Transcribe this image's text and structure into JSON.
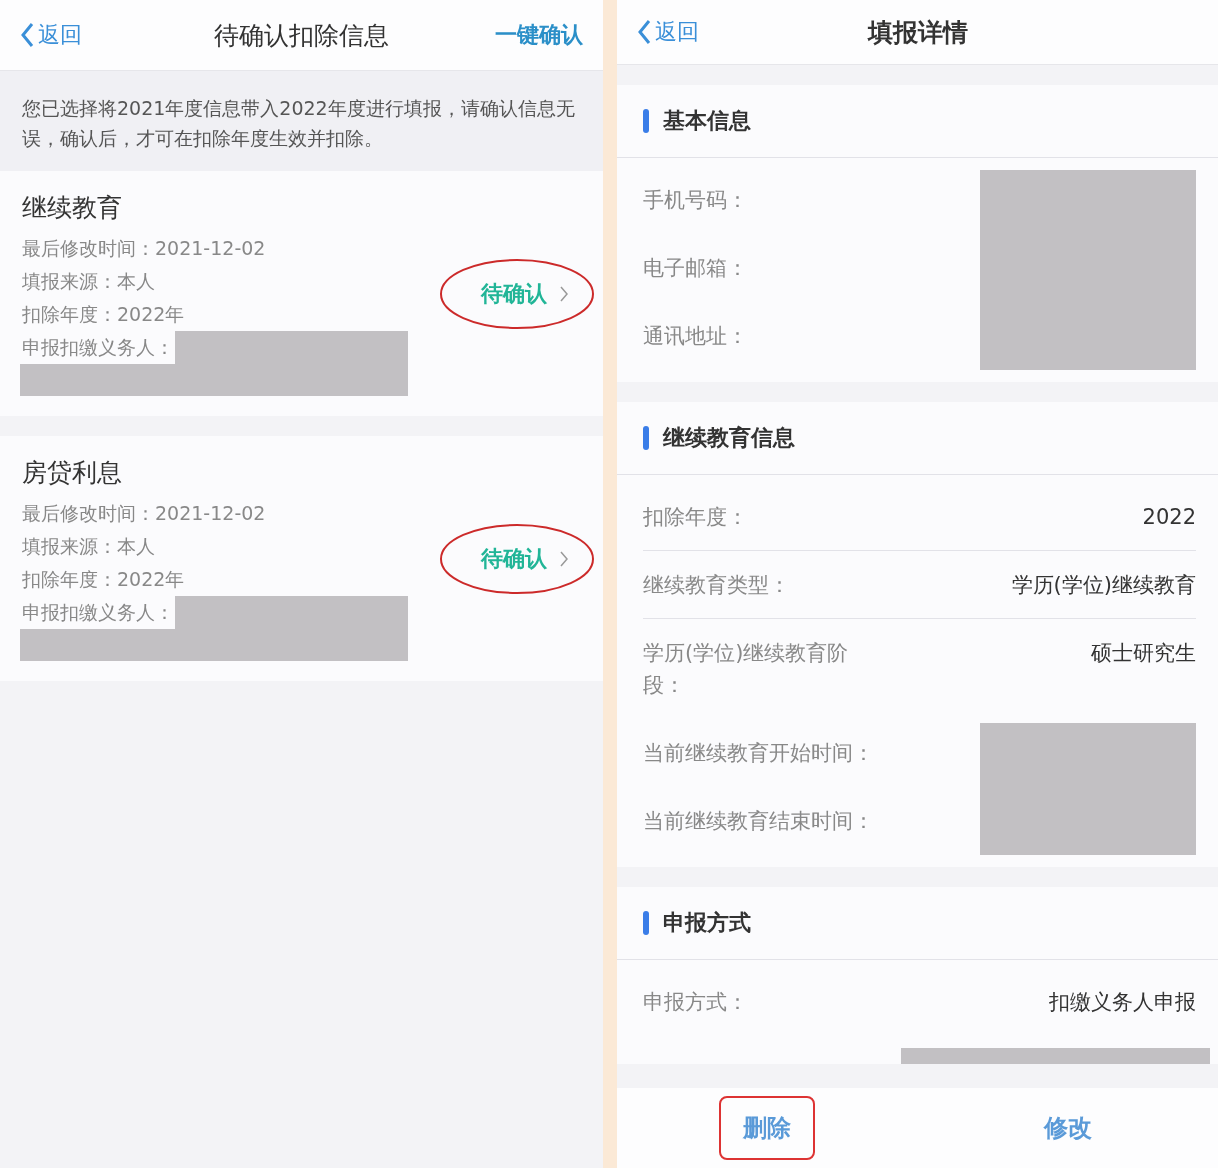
{
  "left": {
    "back": "返回",
    "title": "待确认扣除信息",
    "action": "一键确认",
    "notice": "您已选择将2021年度信息带入2022年度进行填报，请确认信息无误，确认后，才可在扣除年度生效并扣除。",
    "items": [
      {
        "title": "继续教育",
        "status": "待确认",
        "highlighted": true,
        "fields": [
          {
            "label": "最后修改时间：",
            "value": "2021-12-02"
          },
          {
            "label": "填报来源：",
            "value": "本人"
          },
          {
            "label": "扣除年度：",
            "value": "2022年"
          },
          {
            "label": "申报扣缴义务人：",
            "redacted": true
          }
        ]
      },
      {
        "title": "房贷利息",
        "status": "待确认",
        "highlighted": true,
        "fields": [
          {
            "label": "最后修改时间：",
            "value": "2021-12-02"
          },
          {
            "label": "填报来源：",
            "value": "本人"
          },
          {
            "label": "扣除年度：",
            "value": "2022年"
          },
          {
            "label": "申报扣缴义务人：",
            "redacted": true
          }
        ]
      }
    ]
  },
  "right": {
    "back": "返回",
    "title": "填报详情",
    "sections": [
      {
        "title": "基本信息",
        "rows": [
          {
            "label": "手机号码：",
            "redacted": true
          },
          {
            "label": "电子邮箱：",
            "redacted": true
          },
          {
            "label": "通讯地址：",
            "redacted": true
          }
        ]
      },
      {
        "title": "继续教育信息",
        "rows": [
          {
            "label": "扣除年度：",
            "value": "2022",
            "divider": true
          },
          {
            "label": "继续教育类型：",
            "value": "学历(学位)继续教育",
            "divider": true
          },
          {
            "label": "学历(学位)继续教育阶段：",
            "value": "硕士研究生"
          },
          {
            "label": "当前继续教育开始时间：",
            "redacted": true
          },
          {
            "label": "当前继续教育结束时间：",
            "redacted": true
          }
        ]
      },
      {
        "title": "申报方式",
        "rows": [
          {
            "label": "申报方式：",
            "value": "扣缴义务人申报"
          }
        ],
        "trailing_redaction": true
      }
    ],
    "buttons": [
      {
        "label": "删除",
        "highlighted": true
      },
      {
        "label": "修改",
        "highlighted": false
      }
    ]
  }
}
